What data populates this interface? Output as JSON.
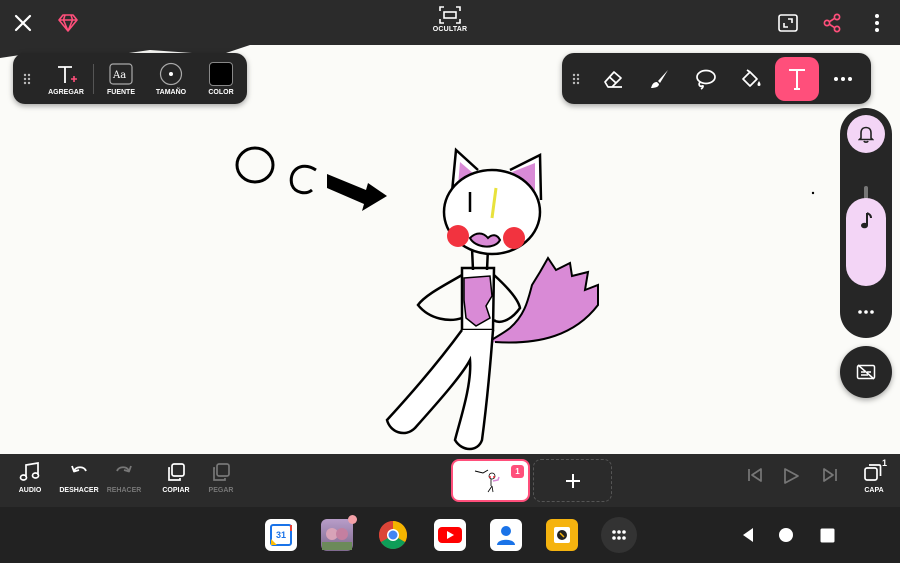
{
  "topbar": {
    "ocultar_label": "OCULTAR",
    "close_icon": "close-icon",
    "premium_icon": "diamond-icon",
    "accent": "#ff4f7b"
  },
  "text_toolbar": {
    "tools": [
      {
        "label": "AGREGAR",
        "icon": "add-text-icon"
      },
      {
        "label": "FUENTE",
        "icon": "font-icon"
      },
      {
        "label": "TAMAÑO",
        "icon": "size-icon"
      },
      {
        "label": "COLOR",
        "icon": "color-swatch"
      }
    ],
    "color_value": "#000000"
  },
  "tools_toolbar": {
    "tools": [
      "eraser-icon",
      "brush-icon",
      "lasso-icon",
      "fill-bucket-icon",
      "text-tool-icon",
      "more-icon"
    ],
    "active": "text-tool-icon"
  },
  "bottombar": {
    "audio_label": "AUDIO",
    "undo_label": "DESHACER",
    "redo_label": "REHACER",
    "copy_label": "COPIAR",
    "paste_label": "PEGAR",
    "layer_label": "CAPA",
    "frame_number": "1",
    "layer_count": "1"
  },
  "canvas": {
    "drawing_text": "OC"
  },
  "dock": {
    "calendar_day": "31",
    "apps": [
      "calendar-app",
      "gallery-app",
      "chrome-app",
      "youtube-app",
      "contacts-app",
      "other-app",
      "app-drawer"
    ]
  }
}
